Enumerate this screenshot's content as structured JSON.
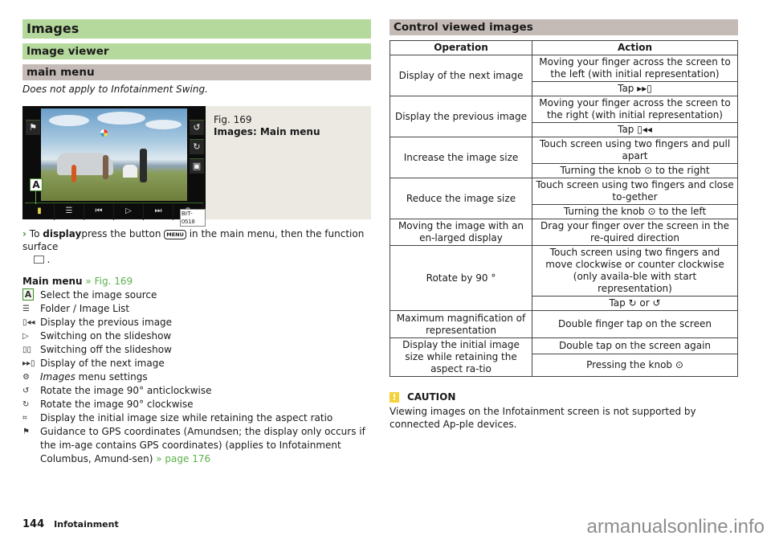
{
  "left": {
    "title": "Images",
    "subtitle": "Image viewer",
    "section": "main menu",
    "note": "Does not apply to Infotainment Swing.",
    "figure": {
      "number": "Fig. 169",
      "caption": "Images: Main menu",
      "code": "BIT-0518",
      "callout": "A",
      "bottom_buttons": [
        "image-source-icon",
        "list-icon",
        "previous-icon",
        "play-icon",
        "next-icon",
        "settings-icon"
      ],
      "side_buttons": [
        "rotate-anticlockwise-icon",
        "rotate-clockwise-icon",
        "fit-size-icon"
      ],
      "top_left_button": "flag-icon"
    },
    "instruction": {
      "arrow": "›",
      "prefix": "To ",
      "bold": "display",
      "middle": "press the button ",
      "menu_key": "MENU",
      "suffix": " in the main menu, then the function surface",
      "end": " ."
    },
    "main_menu": {
      "heading": "Main menu",
      "ref": " » Fig. 169",
      "items": [
        {
          "icon": "A",
          "text": "Select the image source"
        },
        {
          "icon": "☰",
          "text": "Folder / Image List"
        },
        {
          "icon": "▯◂◂",
          "text": "Display the previous image"
        },
        {
          "icon": "▷",
          "text": "Switching on the slideshow"
        },
        {
          "icon": "▯▯",
          "text": "Switching off the slideshow"
        },
        {
          "icon": "▸▸▯",
          "text": "Display of the next image"
        },
        {
          "icon": "⚙",
          "italic": "Images",
          "text": " menu settings"
        },
        {
          "icon": "↺",
          "text": "Rotate the image 90° anticlockwise"
        },
        {
          "icon": "↻",
          "text": "Rotate the image 90° clockwise"
        },
        {
          "icon": "⌗",
          "text": "Display the initial image size while retaining the aspect ratio"
        },
        {
          "icon": "⚑",
          "text": "Guidance to GPS coordinates (Amundsen; the display only occurs if the im-age contains GPS coordinates) (applies to Infotainment Columbus, Amund-sen)",
          "link": " » page 176"
        }
      ]
    }
  },
  "right": {
    "section": "Control viewed images",
    "table": {
      "headers": [
        "Operation",
        "Action"
      ],
      "rows": [
        {
          "operation": "Display of the next image",
          "actions": [
            "Moving your finger across the screen to the left (with initial representation)",
            "Tap ▸▸▯"
          ]
        },
        {
          "operation": "Display the previous image",
          "actions": [
            "Moving your finger across the screen to the right (with initial representation)",
            "Tap ▯◂◂"
          ]
        },
        {
          "operation": "Increase the image size",
          "actions": [
            "Touch screen using two fingers and pull apart",
            "Turning the knob ⊙ to the right"
          ]
        },
        {
          "operation": "Reduce the image size",
          "actions": [
            "Touch screen using two fingers and close to-gether",
            "Turning the knob ⊙ to the left"
          ]
        },
        {
          "operation": "Moving the image with an en-larged display",
          "actions": [
            "Drag your finger over the screen in the re-quired direction"
          ]
        },
        {
          "operation": "Rotate by 90 °",
          "actions": [
            "Touch screen using two fingers and move clockwise or counter clockwise (only availa-ble with start representation)",
            "Tap ↻ or ↺"
          ]
        },
        {
          "operation": "Maximum magnification of representation",
          "actions": [
            "Double finger tap on the screen"
          ]
        },
        {
          "operation": "Display the initial image size while retaining the aspect ra-tio",
          "actions": [
            "Double tap on the screen again",
            "Pressing the knob ⊙"
          ]
        }
      ]
    },
    "caution": {
      "icon": "!",
      "title": "CAUTION",
      "text": "Viewing images on the Infotainment screen is not supported by connected Ap-ple devices."
    }
  },
  "footer": {
    "page_number": "144",
    "section": "Infotainment"
  },
  "watermark": "armanualsonline.info",
  "colors": {
    "heading_green": "#b5d99c",
    "heading_gray": "#c5bbb6",
    "link_green": "#5bb04a",
    "caution_yellow": "#f4d23a"
  }
}
